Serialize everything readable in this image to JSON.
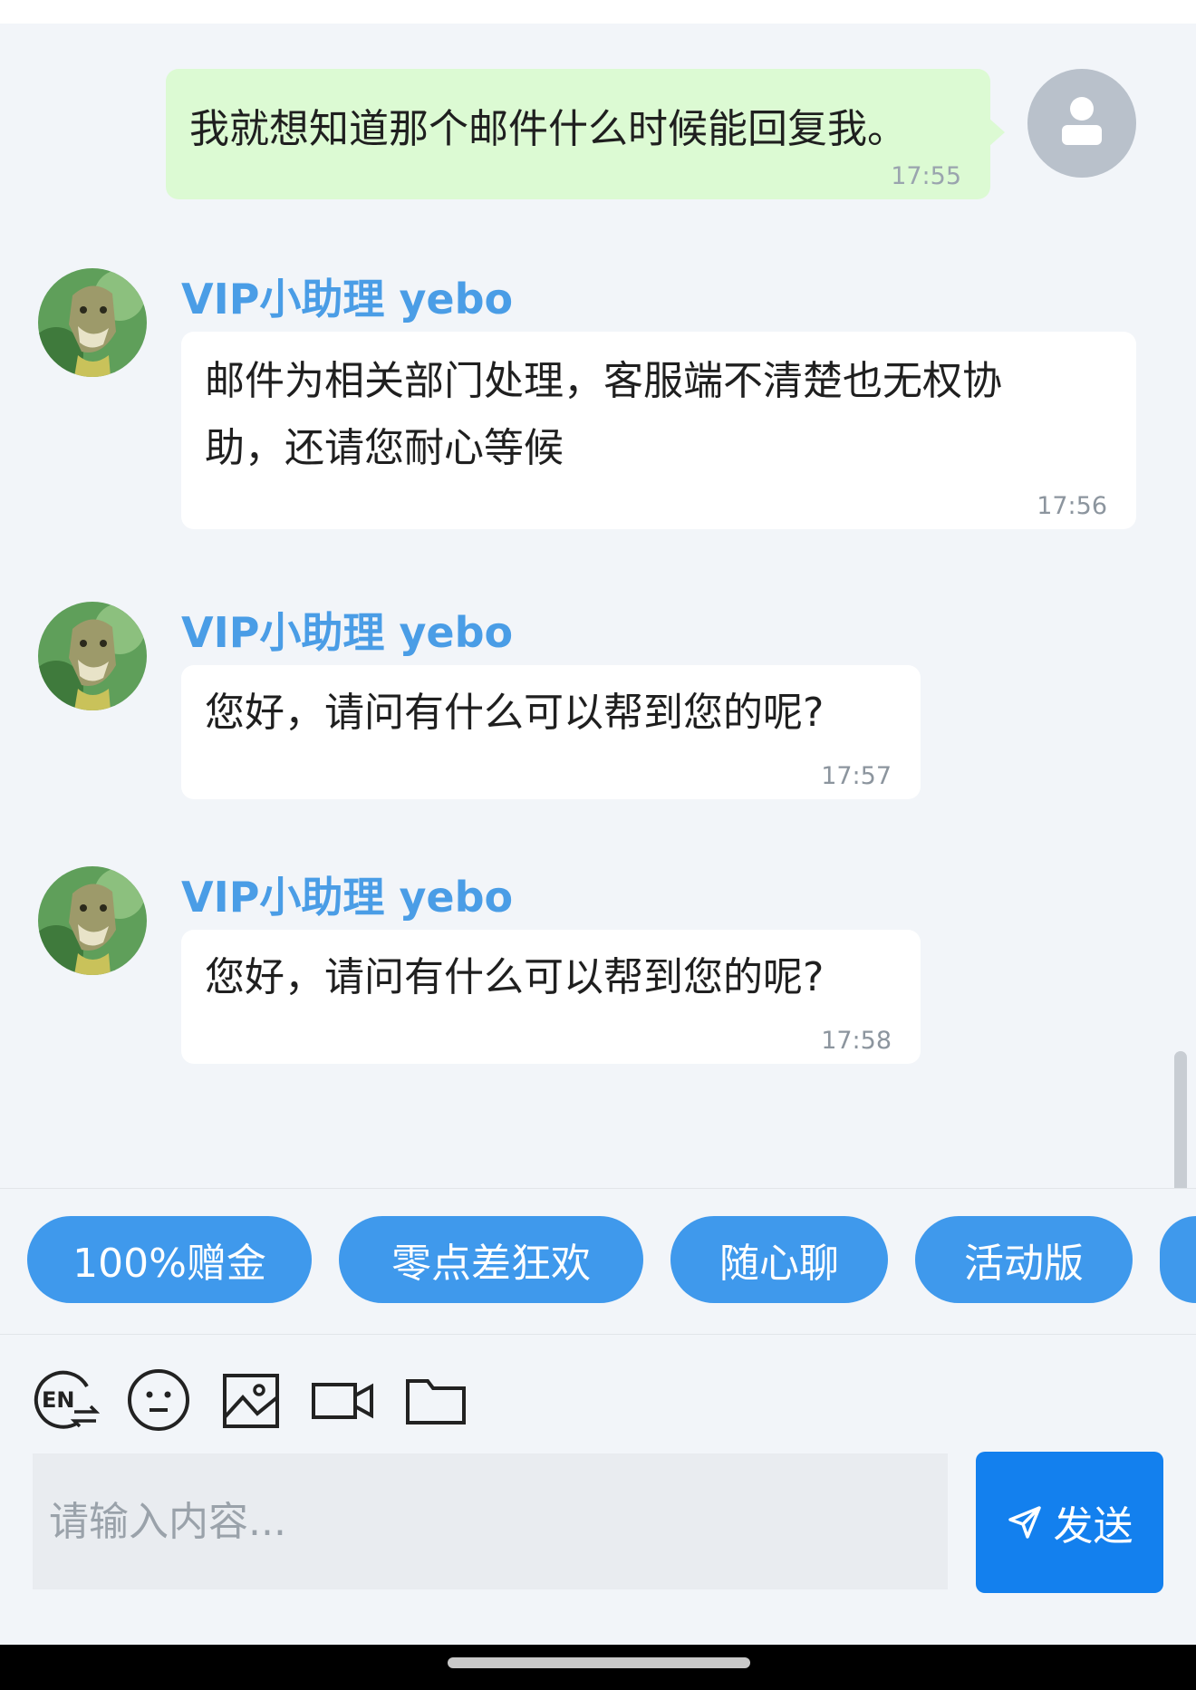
{
  "messages": {
    "user": {
      "text": "我就想知道那个邮件什么时候能回复我。",
      "time": "17:55"
    },
    "agent": [
      {
        "name": "VIP小助理 yebo",
        "lines": [
          "邮件为相关部门处理，客服端不清楚也无权协",
          "助，还请您耐心等候"
        ],
        "time": "17:56"
      },
      {
        "name": "VIP小助理 yebo",
        "lines": [
          "您好，请问有什么可以帮到您的呢?"
        ],
        "time": "17:57"
      },
      {
        "name": "VIP小助理 yebo",
        "lines": [
          "您好，请问有什么可以帮到您的呢?"
        ],
        "time": "17:58"
      }
    ]
  },
  "quick_replies": [
    "100%赠金",
    "零点差狂欢",
    "随心聊",
    "活动版"
  ],
  "toolbar": {
    "icons": [
      "translate-en-icon",
      "emoji-icon",
      "image-icon",
      "video-icon",
      "folder-icon"
    ],
    "translate_label": "EN"
  },
  "composer": {
    "placeholder": "请输入内容...",
    "send_label": "发送",
    "send_icon": "paper-plane-icon"
  },
  "colors": {
    "accent": "#1380ee",
    "chip": "#3f99ec",
    "agent_name": "#4a9de6",
    "user_bubble": "#dcfad3",
    "background": "#f2f5f9"
  }
}
